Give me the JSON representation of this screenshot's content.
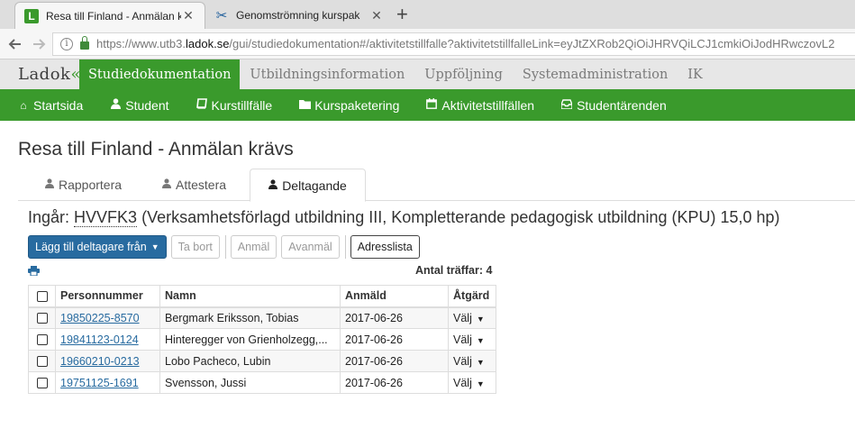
{
  "browser": {
    "tabs": [
      {
        "title": "Resa till Finland - Anmälan kr",
        "active": true
      },
      {
        "title": "Genomströmning kurspak",
        "active": false
      }
    ],
    "url": {
      "prefix": "https://www.utb3.",
      "domain": "ladok.se",
      "suffix": "/gui/studiedokumentation#/aktivitetstillfalle?aktivitetstillfalleLink=eyJtZXRob2QiOiJHRVQiLCJ1cmkiOiJodHRwczovL2"
    }
  },
  "topnav": {
    "logo": "Ladok",
    "items": [
      "Studiedokumentation",
      "Utbildningsinformation",
      "Uppföljning",
      "Systemadministration",
      "IK"
    ]
  },
  "subnav": {
    "items": [
      "Startsida",
      "Student",
      "Kurstillfälle",
      "Kurspaketering",
      "Aktivitetstillfällen",
      "Studentärenden"
    ]
  },
  "page": {
    "title": "Resa till Finland - Anmälan krävs",
    "tabs": [
      "Rapportera",
      "Attestera",
      "Deltagande"
    ],
    "ingar_label": "Ingår:",
    "course_code": "HVVFK3",
    "course_name": "(Verksamhetsförlagd utbildning III, Kompletterande pedagogisk utbildning (KPU) 15,0 hp)",
    "buttons": {
      "add": "Lägg till deltagare från",
      "remove": "Ta bort",
      "register": "Anmäl",
      "unregister": "Avanmäl",
      "address": "Adresslista"
    },
    "hits": "Antal träffar: 4"
  },
  "table": {
    "headers": [
      "Personnummer",
      "Namn",
      "Anmäld",
      "Åtgärd"
    ],
    "rows": [
      {
        "pnr": "19850225-8570",
        "name": "Bergmark Eriksson, Tobias",
        "date": "2017-06-26",
        "action": "Välj"
      },
      {
        "pnr": "19841123-0124",
        "name": "Hinteregger von Grienholzegg,...",
        "date": "2017-06-26",
        "action": "Välj"
      },
      {
        "pnr": "19660210-0213",
        "name": "Lobo Pacheco, Lubin",
        "date": "2017-06-26",
        "action": "Välj"
      },
      {
        "pnr": "19751125-1691",
        "name": "Svensson, Jussi",
        "date": "2017-06-26",
        "action": "Välj"
      }
    ]
  }
}
